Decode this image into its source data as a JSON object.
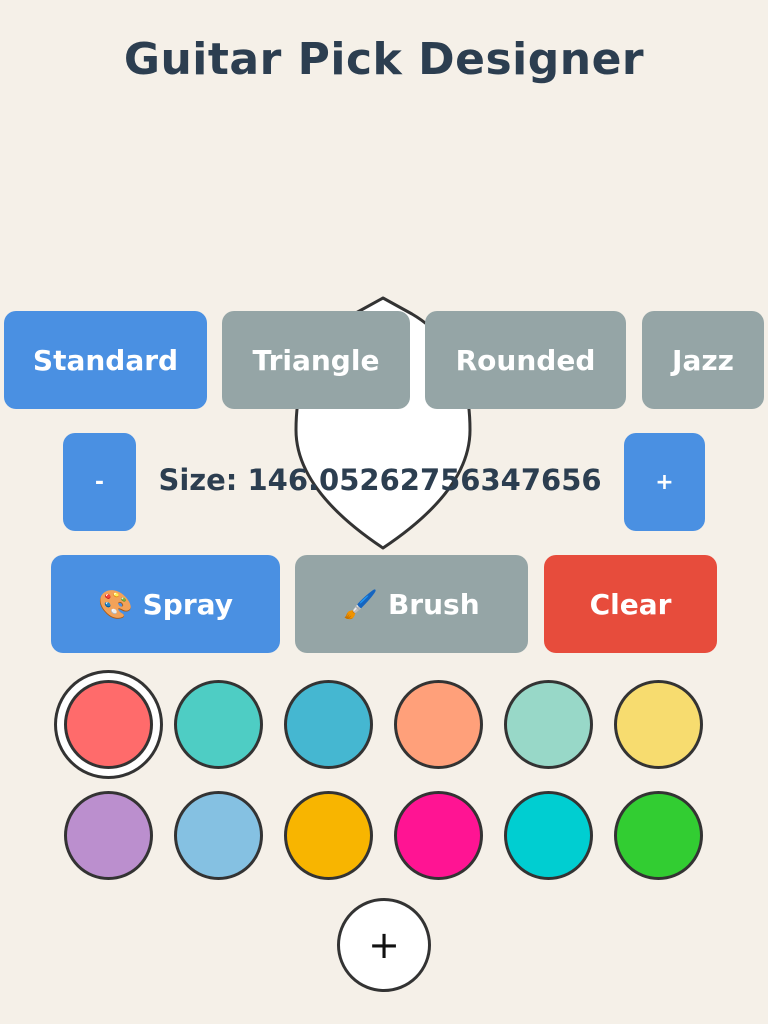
{
  "title": "Guitar Pick Designer",
  "shapes": {
    "standard": "Standard",
    "triangle": "Triangle",
    "rounded": "Rounded",
    "jazz": "Jazz",
    "selected": "Standard"
  },
  "size": {
    "decrease_label": "-",
    "increase_label": "+",
    "text": "Size: 146.05262756347656"
  },
  "tools": {
    "spray": "🎨 Spray",
    "brush": "🖌️ Brush",
    "clear": "Clear",
    "selected": "Spray"
  },
  "palette": {
    "colors": [
      "#ff6b6b",
      "#4ecdc4",
      "#45b7d1",
      "#ffa07a",
      "#98d8c8",
      "#f7dc6f",
      "#bb8fce",
      "#85c1e2",
      "#f8b500",
      "#ff1493",
      "#00ced1",
      "#32cd32"
    ],
    "selected_color": "#ff6b6b",
    "add_label": "+"
  },
  "pick": {
    "fill": "#ffffff",
    "stroke": "#333333"
  }
}
